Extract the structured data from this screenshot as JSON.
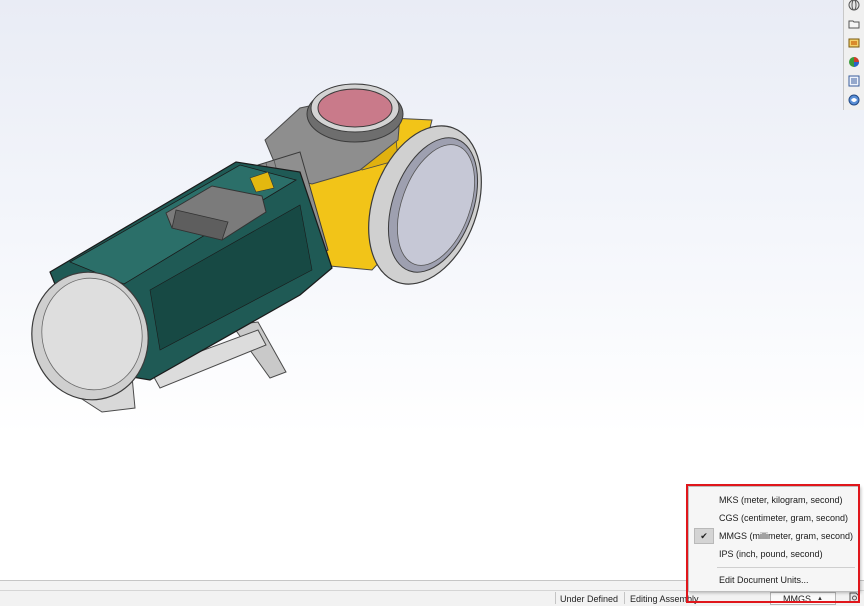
{
  "status_bar": {
    "under_defined": "Under Defined",
    "editing_mode": "Editing Assembly",
    "current_units": "MMGS"
  },
  "units_menu": {
    "items": [
      {
        "label": "MKS (meter, kilogram, second)",
        "checked": false
      },
      {
        "label": "CGS (centimeter, gram, second)",
        "checked": false
      },
      {
        "label": "MMGS (millimeter, gram, second)",
        "checked": true
      },
      {
        "label": "IPS (inch, pound, second)",
        "checked": false
      }
    ],
    "edit_label": "Edit Document Units...",
    "check_glyph": "✔"
  },
  "task_pane": {
    "icons": [
      "solidworks-resources-icon",
      "design-library-icon",
      "file-explorer-icon",
      "appearances-icon",
      "custom-properties-icon",
      "solidworks-forum-icon"
    ]
  },
  "colors": {
    "highlight": "#e0161b",
    "body_green": "#1f5a55",
    "housing_yellow": "#f2c418",
    "lens_pink": "#c97a8a",
    "grey_parts": "#a8a8a8"
  }
}
